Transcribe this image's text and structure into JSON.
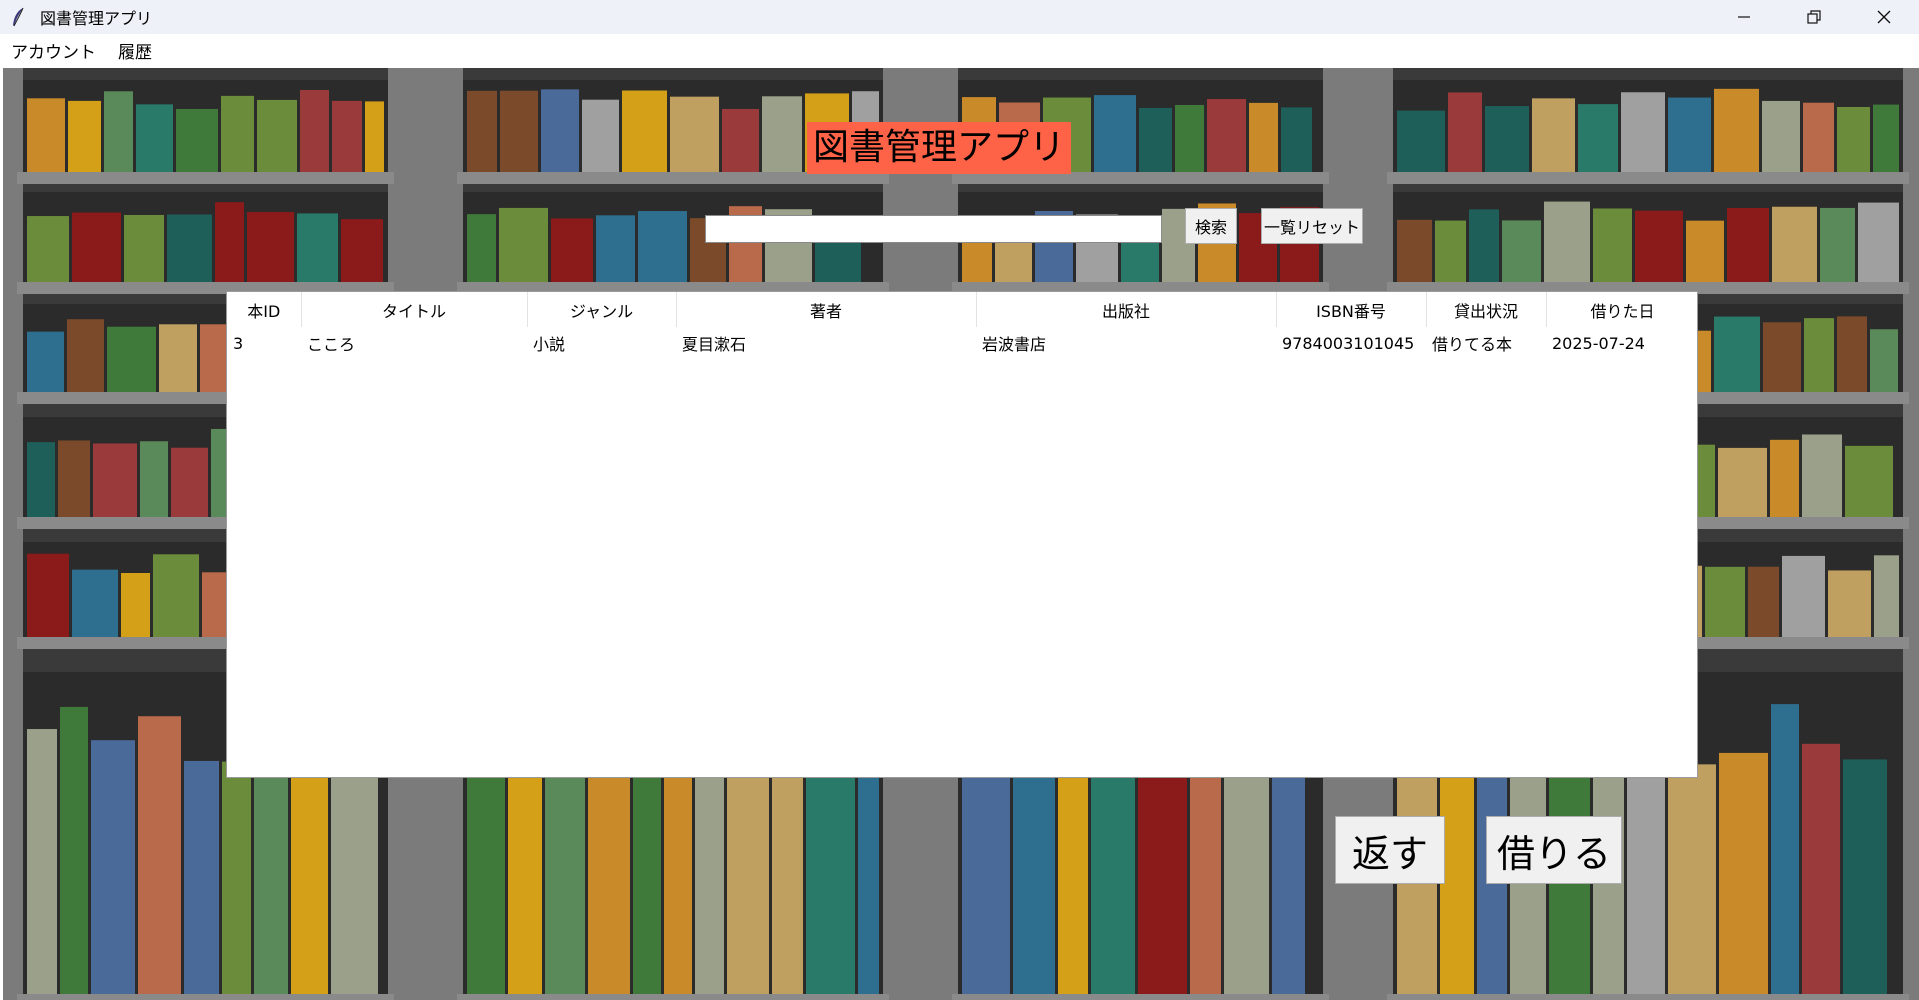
{
  "window": {
    "title": "図書管理アプリ",
    "minimize_icon": "minimize-icon",
    "maximize_icon": "restore-icon",
    "close_icon": "close-icon"
  },
  "menu": {
    "items": [
      {
        "label": "アカウント"
      },
      {
        "label": "履歴"
      }
    ]
  },
  "heading": {
    "text": "図書管理アプリ",
    "background": "#ff6347"
  },
  "search": {
    "value": "",
    "search_label": "検索",
    "reset_label": "一覧リセット"
  },
  "table": {
    "columns": [
      "本ID",
      "タイトル",
      "ジャンル",
      "著者",
      "出版社",
      "ISBN番号",
      "貸出状況",
      "借りた日"
    ],
    "rows": [
      [
        "3",
        "こころ",
        "小説",
        "夏目漱石",
        "岩波書店",
        "9784003101045",
        "借りてる本",
        "2025-07-24"
      ]
    ]
  },
  "actions": {
    "return_label": "返す",
    "borrow_label": "借りる"
  }
}
